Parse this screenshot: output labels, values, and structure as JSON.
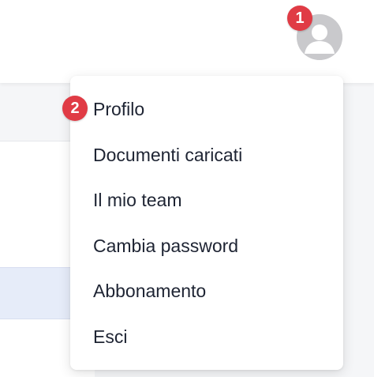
{
  "header": {
    "avatar_icon": "user-avatar-icon"
  },
  "annotations": {
    "badge_1": "1",
    "badge_2": "2",
    "badge_color": "#e03b45"
  },
  "user_menu": {
    "items": [
      {
        "label": "Profilo"
      },
      {
        "label": "Documenti caricati"
      },
      {
        "label": "Il mio team"
      },
      {
        "label": "Cambia password"
      },
      {
        "label": "Abbonamento"
      },
      {
        "label": "Esci"
      }
    ]
  }
}
